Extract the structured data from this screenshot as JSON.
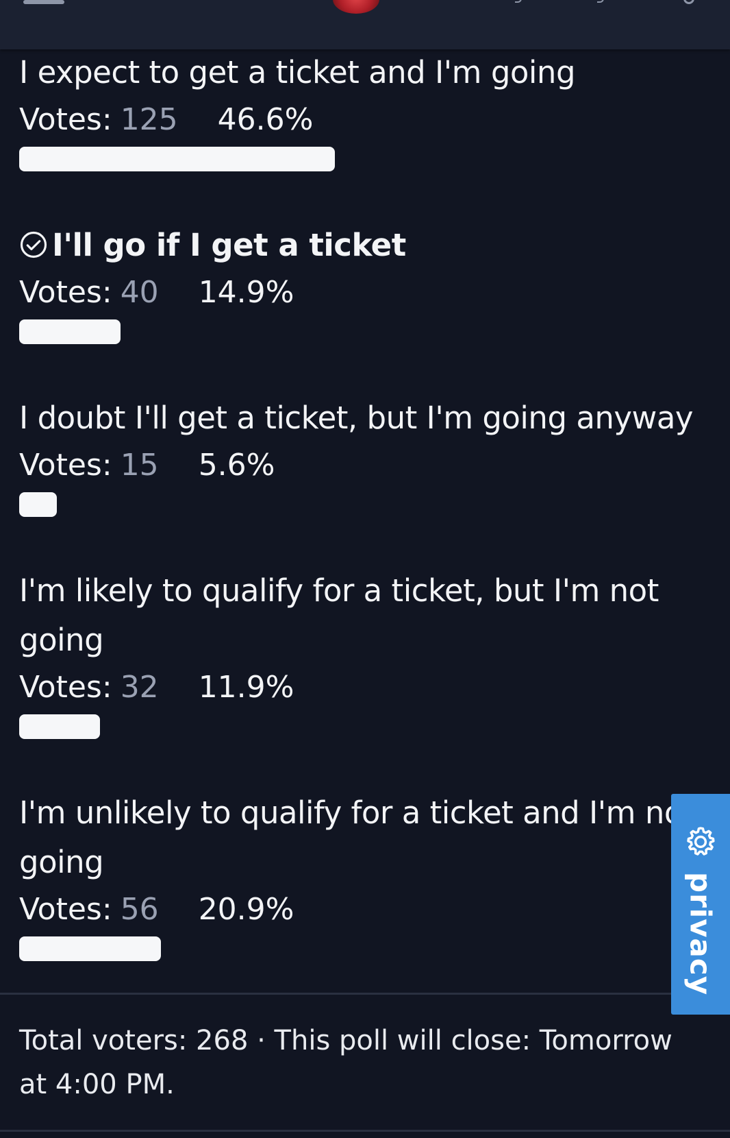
{
  "poll": {
    "options": [
      {
        "title": "I expect to get a ticket and I'm going",
        "votes_label": "Votes:",
        "votes": "125",
        "percent": "46.6%",
        "fraction": 0.466,
        "chosen": false
      },
      {
        "title": "I'll go if I get a ticket",
        "votes_label": "Votes:",
        "votes": "40",
        "percent": "14.9%",
        "fraction": 0.149,
        "chosen": true
      },
      {
        "title": "I doubt I'll get a ticket, but I'm going anyway",
        "votes_label": "Votes:",
        "votes": "15",
        "percent": "5.6%",
        "fraction": 0.056,
        "chosen": false
      },
      {
        "title": "I'm likely to qualify for a ticket, but I'm not going",
        "votes_label": "Votes:",
        "votes": "32",
        "percent": "11.9%",
        "fraction": 0.119,
        "chosen": false
      },
      {
        "title": "I'm unlikely to qualify for a ticket and I'm not going",
        "votes_label": "Votes:",
        "votes": "56",
        "percent": "20.9%",
        "fraction": 0.209,
        "chosen": false
      }
    ],
    "footer": "Total voters: 268 · This poll will close: Tomorrow at 4:00 PM."
  },
  "privacy_tab": {
    "label": "privacy",
    "icon": "gear-icon"
  },
  "colors": {
    "background": "#111522",
    "topbar": "#1b2131",
    "bar": "#f6f7f9",
    "accent": "#3b8ddb",
    "muted": "#9aa1b3"
  }
}
